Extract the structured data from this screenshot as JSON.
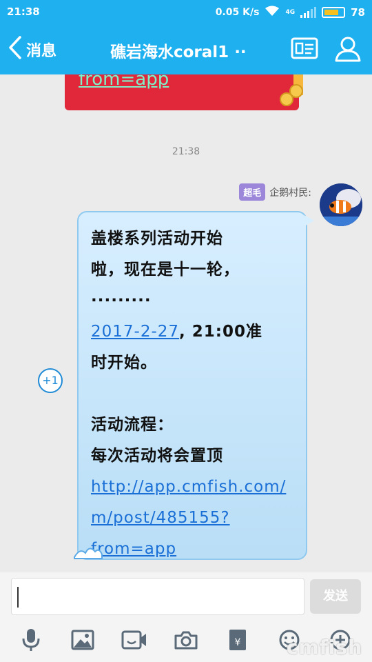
{
  "status": {
    "time": "21:38",
    "speed": "0.05 K/s",
    "network": "4G",
    "battery": "78",
    "battery_level": 0.78
  },
  "header": {
    "back_label": "消息",
    "title": "礁岩海水coral1 ··"
  },
  "chat": {
    "prev_card_link": "from=app",
    "timestamp": "21:38",
    "sender": {
      "badge": "超毛",
      "name": "企鹅村民:"
    },
    "message": {
      "line1": "盖楼系列活动开始",
      "line2": "啦，现在是十一轮，",
      "line3": "·········",
      "date_link": "2017-2-27",
      "line4_rest": ", 21:00准",
      "line5": "时开始。",
      "line6": "活动流程：",
      "line7": "每次活动将会置顶",
      "url_link_1": "http://app.cmfish.com/",
      "url_link_2": "m/post/485155?",
      "url_link_3": "from=app"
    },
    "plus_one": "+1"
  },
  "input": {
    "value": "",
    "send_label": "发送"
  },
  "watermark": "cmfish",
  "colors": {
    "brand": "#1fb0ef",
    "bubble": "#c9e6fb",
    "link": "#1a6fd6",
    "badge": "#9b86d9"
  }
}
